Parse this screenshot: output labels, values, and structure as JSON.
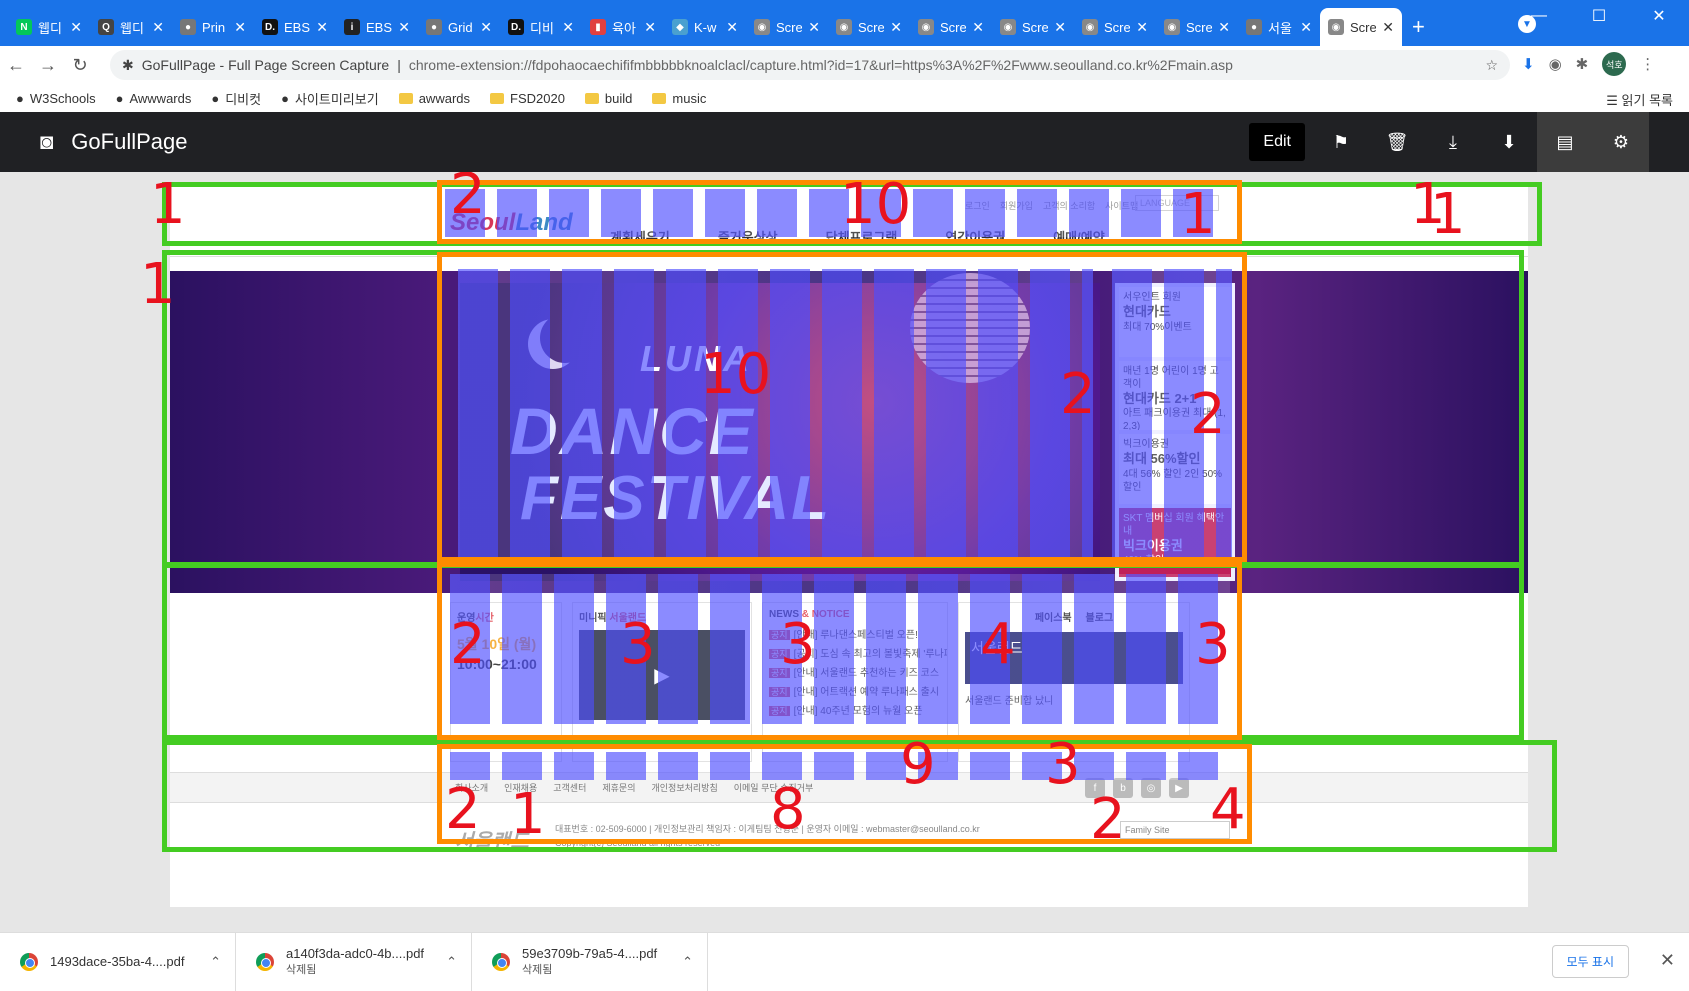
{
  "browser": {
    "tabs": [
      {
        "label": "웹디",
        "icon": "naver-icon",
        "color": "#03c75a",
        "glyph": "N"
      },
      {
        "label": "웹디",
        "icon": "q-icon",
        "color": "#444444",
        "glyph": "Q"
      },
      {
        "label": "Prin",
        "icon": "globe-icon",
        "color": "#777777",
        "glyph": "●"
      },
      {
        "label": "EBS",
        "icon": "d-icon",
        "color": "#111111",
        "glyph": "D."
      },
      {
        "label": "EBS",
        "icon": "i-icon",
        "color": "#222222",
        "glyph": "i"
      },
      {
        "label": "Grid",
        "icon": "globe-icon",
        "color": "#777777",
        "glyph": "●"
      },
      {
        "label": "디비",
        "icon": "d-icon",
        "color": "#111111",
        "glyph": "D."
      },
      {
        "label": "육아",
        "icon": "chart-icon",
        "color": "#e04040",
        "glyph": "▮"
      },
      {
        "label": "K-w",
        "icon": "bird-icon",
        "color": "#4aa0d0",
        "glyph": "◆"
      },
      {
        "label": "Scre",
        "icon": "camera-icon",
        "color": "#888888",
        "glyph": "◉"
      },
      {
        "label": "Scre",
        "icon": "camera-icon",
        "color": "#888888",
        "glyph": "◉"
      },
      {
        "label": "Scre",
        "icon": "camera-icon",
        "color": "#888888",
        "glyph": "◉"
      },
      {
        "label": "Scre",
        "icon": "camera-icon",
        "color": "#888888",
        "glyph": "◉"
      },
      {
        "label": "Scre",
        "icon": "camera-icon",
        "color": "#888888",
        "glyph": "◉"
      },
      {
        "label": "Scre",
        "icon": "camera-icon",
        "color": "#888888",
        "glyph": "◉"
      },
      {
        "label": "서울",
        "icon": "globe-icon",
        "color": "#777777",
        "glyph": "●"
      },
      {
        "label": "Scre",
        "icon": "camera-icon",
        "color": "#888888",
        "glyph": "◉",
        "active": true
      }
    ],
    "address": {
      "title": "GoFullPage - Full Page Screen Capture",
      "url": "chrome-extension://fdpohaocaechififmbbbbbknoalclacl/capture.html?id=17&url=https%3A%2F%2Fwww.seoulland.co.kr%2Fmain.asp"
    },
    "profile": "석호",
    "bookmarks": [
      {
        "label": "W3Schools",
        "type": "w3-icon"
      },
      {
        "label": "Awwwards",
        "type": "w-icon"
      },
      {
        "label": "디비컷",
        "type": "d-icon"
      },
      {
        "label": "사이트미리보기",
        "type": "globe-icon"
      },
      {
        "label": "awwards",
        "type": "folder-icon"
      },
      {
        "label": "FSD2020",
        "type": "folder-icon"
      },
      {
        "label": "build",
        "type": "folder-icon"
      },
      {
        "label": "music",
        "type": "folder-icon"
      }
    ],
    "reading_list": "읽기 목록"
  },
  "gofullpage": {
    "title": "GoFullPage",
    "edit_label": "Edit"
  },
  "site": {
    "logo": {
      "a": "Seoul",
      "b": "Land"
    },
    "topnav": [
      "로그인",
      "회원가입",
      "고객의 소리함",
      "사이트맵"
    ],
    "language": "LANGUAGE",
    "gnb": [
      "계획세우기",
      "즐거운상상",
      "단체프로그램",
      "연간이용권",
      "예매/예약"
    ],
    "hero": {
      "luna": "LUNA",
      "dance": "DANCE",
      "festival": "FESTIVAL"
    },
    "side_cards": [
      {
        "top": "서우인트 회원",
        "main": "현대카드",
        "sub": "최대 70%이벤트"
      },
      {
        "top": "매년 1명 어린이 1명 고객이",
        "main": "현대카드 2+1",
        "sub": "아트 패크이용권 최대 (1, 2,3)"
      },
      {
        "top": "빅크이용권",
        "main": "최대 56%할인",
        "sub": "4대 56% 할인 2인 50% 할인"
      },
      {
        "top": "SKT 멤버십 회원 혜택안내",
        "main": "빅크이용권",
        "sub": "40% 할인"
      }
    ],
    "hours": {
      "title_a": "운영",
      "title_b": "시간",
      "more": "더보기 >",
      "date": "5월 10일 (월)",
      "time": "10:00~21:00",
      "links": [
        "이용요금",
        "공연시간",
        "가이드맵",
        "오시는 길"
      ]
    },
    "video": {
      "title_a": "미니픽 ",
      "title_b": "서울랜드",
      "caption": "봄이..."
    },
    "news": {
      "title_a": "NEWS ",
      "title_b": "& NOTICE",
      "items": [
        "[안내] 루나댄스페스티벌 오픈!",
        "[공지] 도심 속 최고의 볼빛축제 '루나파",
        "[안내] 서울랜드 추천하는 키즈 코스",
        "[안내] 어트랙션 예약 루나패스 출시",
        "[안내] 40주년 모험의 뉴월 오픈"
      ],
      "faq": "FAQ",
      "support": "고객소리함"
    },
    "social_box": {
      "tab_a": "페이스북",
      "tab_b": "블로그",
      "fb_title": "서울랜드",
      "fb_likes": "좋아요 · 27만 좋아요",
      "post_name": "서울랜드",
      "post_sub": "도요일",
      "post_text": "서울랜드 준비합 났니"
    },
    "footer": {
      "links": [
        "회사소개",
        "인재채용",
        "고객센터",
        "제휴문의",
        "개인정보처리방침",
        "이메일 무단 수집거부"
      ],
      "address": "대표번호 : 02-509-6000 | 개인정보관리 책임자 : 이게팀팀 전형준 | 운영자 이메일 : webmaster@seoulland.co.kr",
      "copyright": "Copyright(c) Seoulland all rights reserved",
      "family": "Family Site",
      "logo": "서울랜드"
    }
  },
  "annotations": [
    "1",
    "2",
    "10",
    "1",
    "1",
    "1",
    "10",
    "2",
    "2",
    "1",
    "2",
    "3",
    "3",
    "4",
    "3",
    "9",
    "3",
    "1",
    "2",
    "8",
    "2",
    "4"
  ],
  "downloads": [
    {
      "name": "1493dace-35ba-4....pdf",
      "status": ""
    },
    {
      "name": "a140f3da-adc0-4b....pdf",
      "status": "삭제됨"
    },
    {
      "name": "59e3709b-79a5-4....pdf",
      "status": "삭제됨"
    }
  ],
  "downloads_show_all": "모두 표시",
  "colors": {
    "chrome_blue": "#1a73e8",
    "annotation_red": "#e8121e",
    "box_green": "#44cc22",
    "box_orange": "#ff8c00",
    "overlay_blue": "#5a5aff"
  }
}
